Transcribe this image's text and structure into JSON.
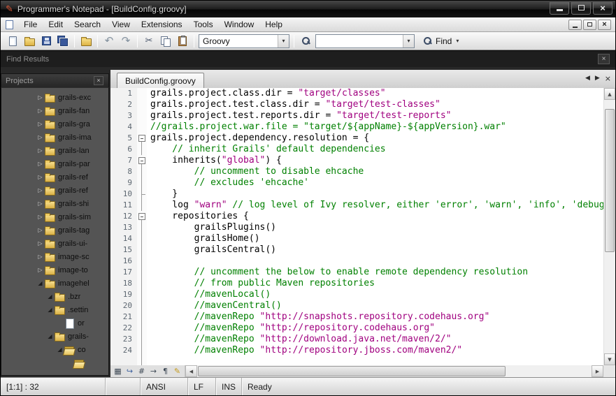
{
  "window": {
    "title": "Programmer's Notepad - [BuildConfig.groovy]"
  },
  "menu": {
    "items": [
      "File",
      "Edit",
      "Search",
      "View",
      "Extensions",
      "Tools",
      "Window",
      "Help"
    ]
  },
  "toolbar": {
    "scheme": "Groovy",
    "search_value": "",
    "find_label": "Find"
  },
  "find_results_panel": {
    "title": "Find Results"
  },
  "projects_panel": {
    "title": "Projects",
    "tree": [
      {
        "label": "grails-exc",
        "depth": 0,
        "state": "collapsed",
        "icon": "folder"
      },
      {
        "label": "grails-fan",
        "depth": 0,
        "state": "collapsed",
        "icon": "folder"
      },
      {
        "label": "grails-gra",
        "depth": 0,
        "state": "collapsed",
        "icon": "folder"
      },
      {
        "label": "grails-ima",
        "depth": 0,
        "state": "collapsed",
        "icon": "folder"
      },
      {
        "label": "grails-lan",
        "depth": 0,
        "state": "collapsed",
        "icon": "folder"
      },
      {
        "label": "grails-par",
        "depth": 0,
        "state": "collapsed",
        "icon": "folder"
      },
      {
        "label": "grails-ref",
        "depth": 0,
        "state": "collapsed",
        "icon": "folder"
      },
      {
        "label": "grails-ref",
        "depth": 0,
        "state": "collapsed",
        "icon": "folder"
      },
      {
        "label": "grails-shi",
        "depth": 0,
        "state": "collapsed",
        "icon": "folder"
      },
      {
        "label": "grails-sim",
        "depth": 0,
        "state": "collapsed",
        "icon": "folder"
      },
      {
        "label": "grails-tag",
        "depth": 0,
        "state": "collapsed",
        "icon": "folder"
      },
      {
        "label": "grails-ui-",
        "depth": 0,
        "state": "collapsed",
        "icon": "folder"
      },
      {
        "label": "image-sc",
        "depth": 0,
        "state": "collapsed",
        "icon": "folder"
      },
      {
        "label": "image-to",
        "depth": 0,
        "state": "collapsed",
        "icon": "folder"
      },
      {
        "label": "imagehel",
        "depth": 0,
        "state": "expanded",
        "icon": "folder"
      },
      {
        "label": ".bzr",
        "depth": 1,
        "state": "expanded",
        "icon": "folder"
      },
      {
        "label": ".settin",
        "depth": 1,
        "state": "expanded",
        "icon": "folder"
      },
      {
        "label": "or",
        "depth": 2,
        "state": "none",
        "icon": "file"
      },
      {
        "label": "grails-",
        "depth": 1,
        "state": "expanded",
        "icon": "folder"
      },
      {
        "label": "co",
        "depth": 2,
        "state": "expanded",
        "icon": "folder-open"
      },
      {
        "label": "",
        "depth": 3,
        "state": "none",
        "icon": "folder-open"
      }
    ]
  },
  "editor": {
    "tab_label": "BuildConfig.groovy",
    "margin_buttons": [
      {
        "name": "bookmark-margin-icon",
        "glyph": "▦",
        "color": "#3f4a56"
      },
      {
        "name": "word-wrap-icon",
        "glyph": "↪",
        "color": "#3b5f9e"
      },
      {
        "name": "line-numbers-icon",
        "glyph": "#",
        "color": "#3f4a56"
      },
      {
        "name": "whitespace-icon",
        "glyph": "→",
        "color": "#3f4a56"
      },
      {
        "name": "line-endings-icon",
        "glyph": "¶",
        "color": "#3f4a56"
      },
      {
        "name": "scheme-tools-icon",
        "glyph": "✎",
        "color": "#c59a1a"
      }
    ],
    "lines": [
      {
        "n": 1,
        "fold": null,
        "seg": [
          [
            "def",
            "grails.project.class.dir = "
          ],
          [
            "str",
            "\"target/classes\""
          ]
        ]
      },
      {
        "n": 2,
        "fold": null,
        "seg": [
          [
            "def",
            "grails.project.test.class.dir = "
          ],
          [
            "str",
            "\"target/test-classes\""
          ]
        ]
      },
      {
        "n": 3,
        "fold": null,
        "seg": [
          [
            "def",
            "grails.project.test.reports.dir = "
          ],
          [
            "str",
            "\"target/test-reports\""
          ]
        ]
      },
      {
        "n": 4,
        "fold": null,
        "seg": [
          [
            "com",
            "//grails.project.war.file = \"target/${appName}-${appVersion}.war\""
          ]
        ]
      },
      {
        "n": 5,
        "fold": "box",
        "seg": [
          [
            "def",
            "grails.project.dependency.resolution = {"
          ]
        ]
      },
      {
        "n": 6,
        "fold": "v",
        "seg": [
          [
            "com",
            "    // inherit Grails' default dependencies"
          ]
        ]
      },
      {
        "n": 7,
        "fold": "box",
        "seg": [
          [
            "def",
            "    inherits("
          ],
          [
            "str",
            "\"global\""
          ],
          [
            "def",
            ") {"
          ]
        ]
      },
      {
        "n": 8,
        "fold": "v",
        "seg": [
          [
            "com",
            "        // uncomment to disable ehcache"
          ]
        ]
      },
      {
        "n": 9,
        "fold": "v",
        "seg": [
          [
            "com",
            "        // excludes 'ehcache'"
          ]
        ]
      },
      {
        "n": 10,
        "fold": "t",
        "seg": [
          [
            "def",
            "    }"
          ]
        ]
      },
      {
        "n": 11,
        "fold": "v",
        "seg": [
          [
            "def",
            "    log "
          ],
          [
            "str",
            "\"warn\""
          ],
          [
            "com",
            " // log level of Ivy resolver, either 'error', 'warn', 'info', 'debug' or 'verbose'"
          ]
        ]
      },
      {
        "n": 12,
        "fold": "box",
        "seg": [
          [
            "def",
            "    repositories {"
          ]
        ]
      },
      {
        "n": 13,
        "fold": "v",
        "seg": [
          [
            "def",
            "        grailsPlugins()"
          ]
        ]
      },
      {
        "n": 14,
        "fold": "v",
        "seg": [
          [
            "def",
            "        grailsHome()"
          ]
        ]
      },
      {
        "n": 15,
        "fold": "v",
        "seg": [
          [
            "def",
            "        grailsCentral()"
          ]
        ]
      },
      {
        "n": 16,
        "fold": "v",
        "seg": []
      },
      {
        "n": 17,
        "fold": "v",
        "seg": [
          [
            "com",
            "        // uncomment the below to enable remote dependency resolution"
          ]
        ]
      },
      {
        "n": 18,
        "fold": "v",
        "seg": [
          [
            "com",
            "        // from public Maven repositories"
          ]
        ]
      },
      {
        "n": 19,
        "fold": "v",
        "seg": [
          [
            "com",
            "        //mavenLocal()"
          ]
        ]
      },
      {
        "n": 20,
        "fold": "v",
        "seg": [
          [
            "com",
            "        //mavenCentral()"
          ]
        ]
      },
      {
        "n": 21,
        "fold": "v",
        "seg": [
          [
            "com",
            "        //mavenRepo "
          ],
          [
            "str",
            "\"http://snapshots.repository.codehaus.org\""
          ]
        ]
      },
      {
        "n": 22,
        "fold": "v",
        "seg": [
          [
            "com",
            "        //mavenRepo "
          ],
          [
            "str",
            "\"http://repository.codehaus.org\""
          ]
        ]
      },
      {
        "n": 23,
        "fold": "v",
        "seg": [
          [
            "com",
            "        //mavenRepo "
          ],
          [
            "str",
            "\"http://download.java.net/maven/2/\""
          ]
        ]
      },
      {
        "n": 24,
        "fold": "v",
        "seg": [
          [
            "com",
            "        //mavenRepo "
          ],
          [
            "str",
            "\"http://repository.jboss.com/maven2/\""
          ]
        ]
      }
    ]
  },
  "statusbar": {
    "position": "[1:1] : 32",
    "encoding": "ANSI",
    "line_ending": "LF",
    "insert_mode": "INS",
    "message": "Ready"
  },
  "icons": {
    "close": "×",
    "caret_down": "▾",
    "tree_collapsed": "▷",
    "tree_expanded": "◢",
    "nav_prev": "◀",
    "nav_next": "▶",
    "scroll_up": "▲",
    "scroll_down": "▼",
    "scroll_left": "◀",
    "scroll_right": "▶",
    "undo": "↶",
    "redo": "↷",
    "cut": "✂"
  },
  "colors": {
    "string": "#a0007f",
    "comment": "#008000",
    "code": "#000000"
  }
}
